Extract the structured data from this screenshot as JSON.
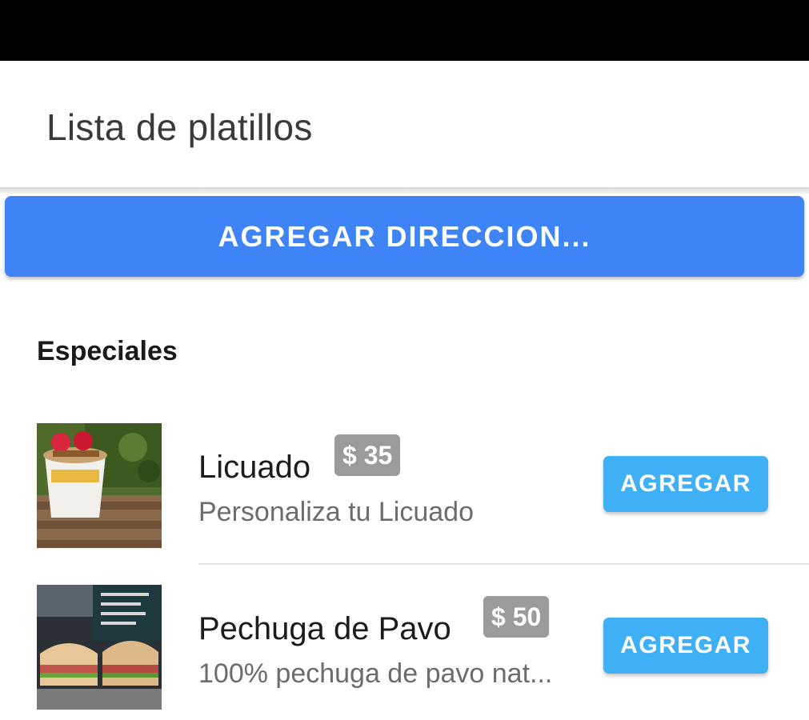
{
  "header": {
    "title": "Lista de platillos"
  },
  "address_button": {
    "label": "AGREGAR DIRECCION..."
  },
  "section": {
    "title": "Especiales"
  },
  "dishes": [
    {
      "name": "Licuado",
      "price": "$ 35",
      "description": "Personaliza tu Licuado",
      "button_label": "AGREGAR",
      "image": "smoothie-cup-photo"
    },
    {
      "name": "Pechuga de Pavo",
      "price": "$ 50",
      "description": "100% pechuga de pavo nat...",
      "button_label": "AGREGAR",
      "image": "turkey-sandwich-photo"
    }
  ],
  "colors": {
    "primary_button": "#3f84f7",
    "add_button": "#3fb0f6",
    "price_badge": "#9b9b9b"
  }
}
